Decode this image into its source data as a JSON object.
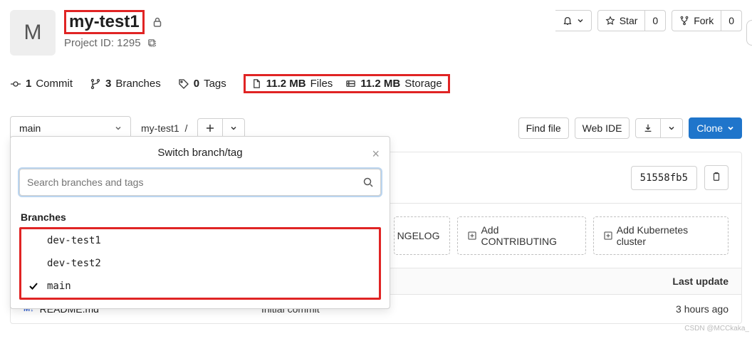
{
  "project": {
    "avatar_letter": "M",
    "name": "my-test1",
    "id_label": "Project ID: 1295"
  },
  "actions": {
    "star_label": "Star",
    "star_count": "0",
    "fork_label": "Fork",
    "fork_count": "0"
  },
  "stats": {
    "commits_count": "1",
    "commits_label": "Commit",
    "branches_count": "3",
    "branches_label": "Branches",
    "tags_count": "0",
    "tags_label": "Tags",
    "files_size": "11.2 MB",
    "files_label": "Files",
    "storage_size": "11.2 MB",
    "storage_label": "Storage"
  },
  "toolbar": {
    "branch_selected": "main",
    "breadcrumb": "my-test1",
    "find_file": "Find file",
    "web_ide": "Web IDE",
    "clone": "Clone"
  },
  "dropdown": {
    "title": "Switch branch/tag",
    "search_placeholder": "Search branches and tags",
    "section_label": "Branches",
    "branches": [
      {
        "name": "dev-test1",
        "checked": false
      },
      {
        "name": "dev-test2",
        "checked": false
      },
      {
        "name": "main",
        "checked": true
      }
    ]
  },
  "commit": {
    "sha": "51558fb5"
  },
  "suggestions": {
    "changelog_partial": "NGELOG",
    "contributing": "Add CONTRIBUTING",
    "kubernetes": "Add Kubernetes cluster"
  },
  "files_table": {
    "header_last_update": "Last update",
    "rows": [
      {
        "icon": "M↓",
        "name": "README.md",
        "commit": "Initial commit",
        "updated": "3 hours ago"
      }
    ]
  },
  "watermark": "CSDN @MCCkaka_"
}
